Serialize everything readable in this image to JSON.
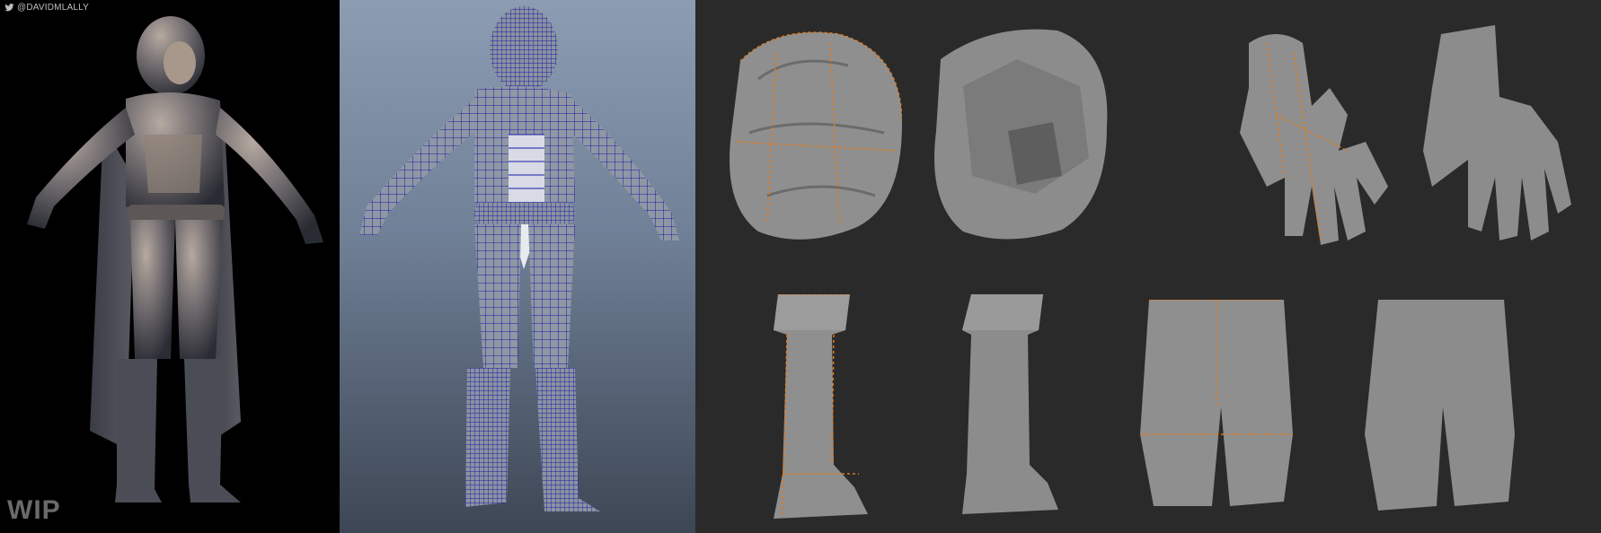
{
  "watermark": {
    "handle": "@DAVIDMLALLY",
    "icon": "twitter-bird-icon"
  },
  "status_label": "WIP",
  "colors": {
    "render_bg": "#000000",
    "wire_bg_top": "#8c9cb2",
    "wire_bg_bottom": "#3d4654",
    "wire_color": "#1a1aa8",
    "parts_bg": "#2a2a2a",
    "clay": "#9a9a9a",
    "seam": "#e07a1e"
  }
}
